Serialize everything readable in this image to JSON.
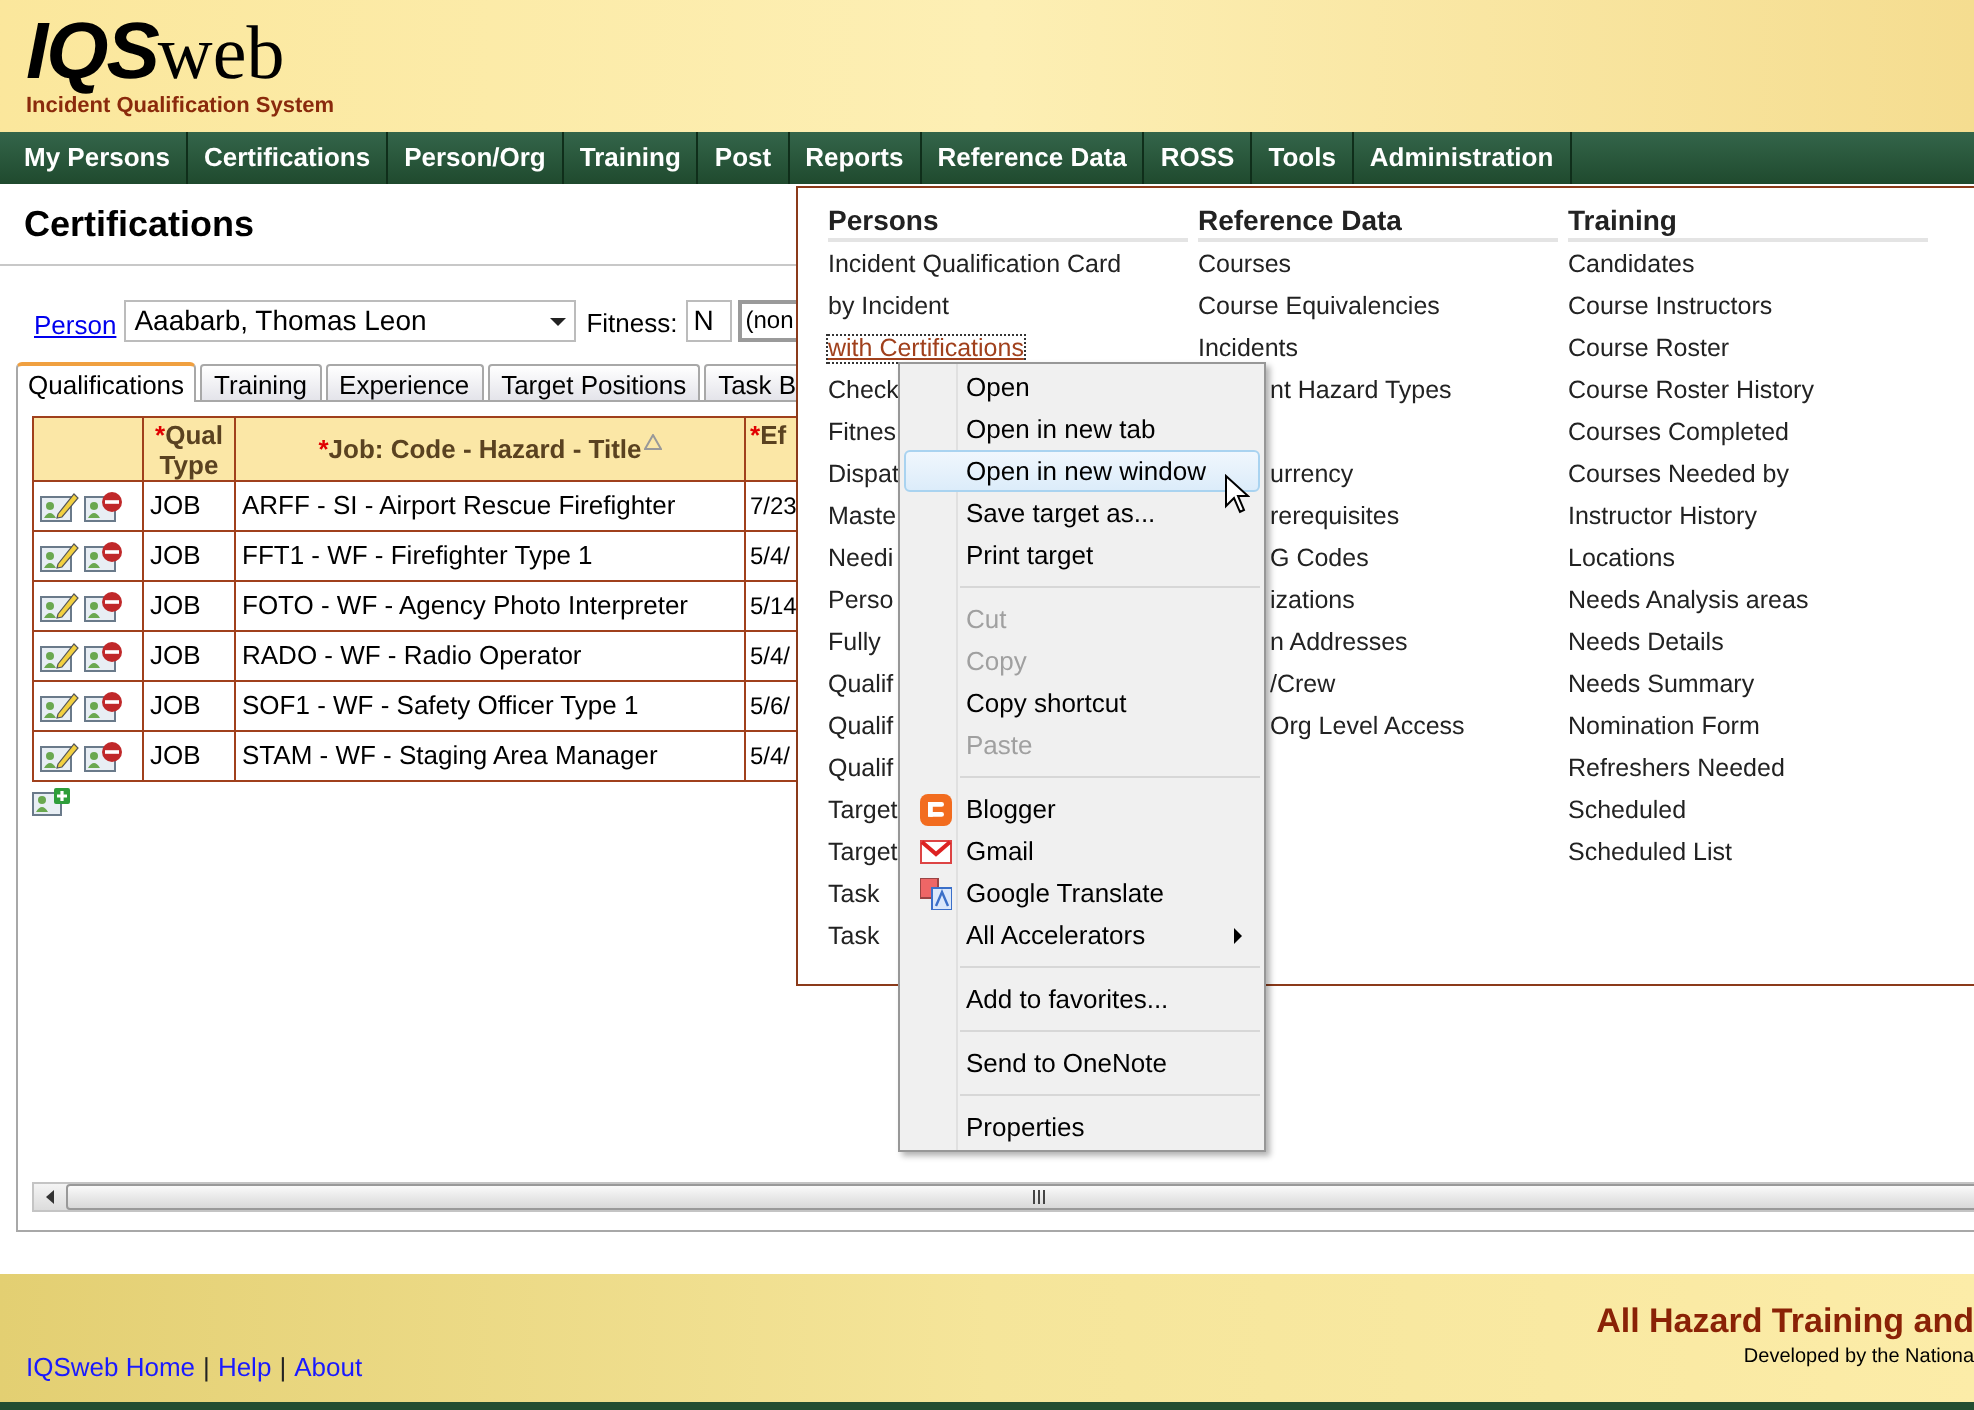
{
  "header": {
    "logo": "IQS",
    "logo_suffix": "web",
    "tagline": "Incident Qualification System"
  },
  "nav": [
    "My Persons",
    "Certifications",
    "Person/Org",
    "Training",
    "Post",
    "Reports",
    "Reference Data",
    "ROSS",
    "Tools",
    "Administration"
  ],
  "page_title": "Certifications",
  "person_bar": {
    "person_link": "Person",
    "person_value": "Aaabarb, Thomas Leon",
    "fitness_label": "Fitness:",
    "fitness_value": "N",
    "status_value": "(non"
  },
  "tabs": [
    {
      "label": "Qualifications",
      "selected": true
    },
    {
      "label": "Training",
      "selected": false
    },
    {
      "label": "Experience",
      "selected": false
    },
    {
      "label": "Target Positions",
      "selected": false
    },
    {
      "label": "Task B",
      "selected": false
    }
  ],
  "table": {
    "columns": [
      {
        "label": "Qual Type",
        "marker": "*",
        "sorted": false
      },
      {
        "label": "Job: Code - Hazard - Title",
        "marker": "*",
        "sorted": true
      },
      {
        "label": "Ef",
        "marker": "*",
        "sorted": false
      }
    ],
    "rows": [
      {
        "qual_type": "JOB",
        "job": "ARFF - SI - Airport Rescue Firefighter",
        "date": "7/23"
      },
      {
        "qual_type": "JOB",
        "job": "FFT1 - WF - Firefighter Type 1",
        "date": "5/4/"
      },
      {
        "qual_type": "JOB",
        "job": "FOTO - WF - Agency Photo Interpreter",
        "date": "5/14"
      },
      {
        "qual_type": "JOB",
        "job": "RADO - WF - Radio Operator",
        "date": "5/4/"
      },
      {
        "qual_type": "JOB",
        "job": "SOF1 - WF - Safety Officer Type 1",
        "date": "5/6/"
      },
      {
        "qual_type": "JOB",
        "job": "STAM - WF - Staging Area Manager",
        "date": "5/4/"
      }
    ]
  },
  "reports_menu": {
    "persons": {
      "heading": "Persons",
      "items": [
        {
          "label": "Incident Qualification Card",
          "focused": false
        },
        {
          "label": "by Incident",
          "focused": false
        },
        {
          "label": "with Certifications",
          "focused": true
        },
        {
          "label": "Check",
          "focused": false
        },
        {
          "label": "Fitnes",
          "focused": false
        },
        {
          "label": "Dispat",
          "focused": false
        },
        {
          "label": "Maste",
          "focused": false
        },
        {
          "label": "Needi",
          "focused": false
        },
        {
          "label": "Perso",
          "focused": false
        },
        {
          "label": "Fully",
          "focused": false
        },
        {
          "label": "Qualif",
          "focused": false
        },
        {
          "label": "Qualif",
          "focused": false
        },
        {
          "label": "Qualif",
          "focused": false
        },
        {
          "label": "Target",
          "focused": false
        },
        {
          "label": "Target",
          "focused": false
        },
        {
          "label": "Task",
          "focused": false
        },
        {
          "label": "Task",
          "focused": false
        }
      ]
    },
    "reference_data": {
      "heading": "Reference Data",
      "items": [
        {
          "label": "Courses",
          "kind": "full"
        },
        {
          "label": "Course Equivalencies",
          "kind": "full"
        },
        {
          "label": "Incidents",
          "kind": "full"
        },
        {
          "label": "nt Hazard Types",
          "kind": "partial"
        },
        {
          "label": "urrency",
          "kind": "spaced"
        },
        {
          "label": "rerequisites",
          "kind": "partial"
        },
        {
          "label": "G Codes",
          "kind": "partial"
        },
        {
          "label": "izations",
          "kind": "partial"
        },
        {
          "label": "n Addresses",
          "kind": "partial"
        },
        {
          "label": "/Crew",
          "kind": "partial"
        },
        {
          "label": "Org Level Access",
          "kind": "partial"
        }
      ]
    },
    "training": {
      "heading": "Training",
      "items": [
        "Candidates",
        "Course Instructors",
        "Course Roster",
        "Course Roster History",
        "Courses Completed",
        "Courses Needed by",
        "Instructor History",
        "Locations",
        "Needs Analysis areas",
        "Needs Details",
        "Needs Summary",
        "Nomination Form",
        "Refreshers Needed",
        "Scheduled",
        "Scheduled List"
      ]
    }
  },
  "context_menu": {
    "groups": [
      [
        {
          "label": "Open",
          "kind": "plain",
          "disabled": false,
          "highlighted": false
        },
        {
          "label": "Open in new tab",
          "kind": "plain",
          "disabled": false,
          "highlighted": false
        },
        {
          "label": "Open in new window",
          "kind": "plain",
          "disabled": false,
          "highlighted": true
        },
        {
          "label": "Save target as...",
          "kind": "plain",
          "disabled": false,
          "highlighted": false
        },
        {
          "label": "Print target",
          "kind": "plain",
          "disabled": false,
          "highlighted": false
        }
      ],
      [
        {
          "label": "Cut",
          "kind": "plain",
          "disabled": true,
          "highlighted": false
        },
        {
          "label": "Copy",
          "kind": "plain",
          "disabled": true,
          "highlighted": false
        },
        {
          "label": "Copy shortcut",
          "kind": "plain",
          "disabled": false,
          "highlighted": false
        },
        {
          "label": "Paste",
          "kind": "plain",
          "disabled": true,
          "highlighted": false
        }
      ],
      [
        {
          "label": "Blogger",
          "kind": "blogger",
          "disabled": false,
          "highlighted": false
        },
        {
          "label": "Gmail",
          "kind": "gmail",
          "disabled": false,
          "highlighted": false
        },
        {
          "label": "Google Translate",
          "kind": "translate",
          "disabled": false,
          "highlighted": false
        },
        {
          "label": "All Accelerators",
          "kind": "submenu",
          "disabled": false,
          "highlighted": false
        }
      ],
      [
        {
          "label": "Add to favorites...",
          "kind": "plain",
          "disabled": false,
          "highlighted": false
        }
      ],
      [
        {
          "label": "Send to OneNote",
          "kind": "plain",
          "disabled": false,
          "highlighted": false
        }
      ],
      [
        {
          "label": "Properties",
          "kind": "plain",
          "disabled": false,
          "highlighted": false
        }
      ]
    ]
  },
  "footer": {
    "links": [
      {
        "label": "IQSweb Home",
        "separator": "|"
      },
      {
        "label": "Help",
        "separator": "|"
      },
      {
        "label": "About"
      }
    ],
    "title": "All Hazard Training and",
    "credit": "Developed by the Nationa"
  }
}
